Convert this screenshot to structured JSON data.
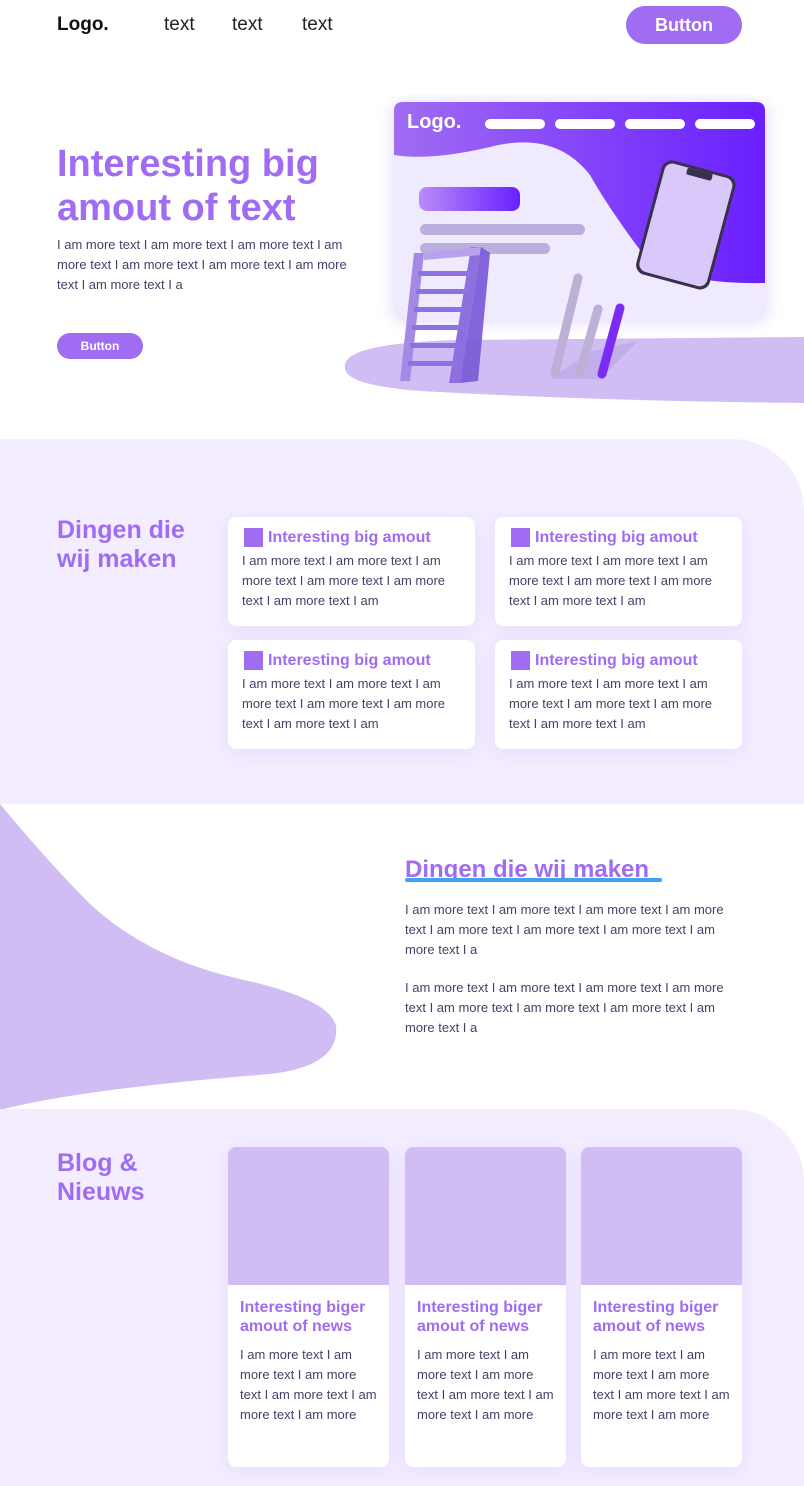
{
  "nav": {
    "logo": "Logo.",
    "links": [
      "text",
      "text",
      "text"
    ],
    "button": "Button"
  },
  "hero": {
    "title": "Interesting big amout of text",
    "description": "I am more text I am more text I am more text I am more text I am more text I am more text I am more text I am more text I a",
    "button": "Button",
    "illustration_logo": "Logo."
  },
  "section_services": {
    "title": "Dingen die wij maken",
    "cards": [
      {
        "title": "Interesting big amout",
        "text": "I am more text I am more text I am more text I am more text I am more text I am more text I am"
      },
      {
        "title": "Interesting big amout",
        "text": "I am more text I am more text I am more text I am more text I am more text I am more text I am"
      },
      {
        "title": "Interesting big amout",
        "text": "I am more text I am more text I am more text I am more text I am more text I am more text I am"
      },
      {
        "title": "Interesting big amout",
        "text": "I am more text I am more text I am more text I am more text I am more text I am more text I am"
      }
    ]
  },
  "section_about": {
    "title": "Dingen die wij maken",
    "paragraphs": [
      "I am more text I am more text I am more text I am more text I am more text I am more text I am more text I am more text I a",
      "I am more text I am more text I am more text I am more text I am more text I am more text I am more text I am more text I a"
    ]
  },
  "section_blog": {
    "title": "Blog & Nieuws",
    "posts": [
      {
        "title": "Interesting biger amout  of news",
        "text": "I am more text I am more text I am more text I am more text I am more text I am more"
      },
      {
        "title": "Interesting biger amout  of news",
        "text": "I am more text I am more text I am more text I am more text I am more text I am more"
      },
      {
        "title": "Interesting biger amout  of news",
        "text": "I am more text I am more text I am more text I am more text I am more text I am more"
      }
    ]
  },
  "colors": {
    "accent": "#a06cf2",
    "accent_dark": "#6a1fff",
    "soft_bg": "#f3edff",
    "lavender": "#d0bdf4",
    "underline": "#3ea3f5"
  }
}
